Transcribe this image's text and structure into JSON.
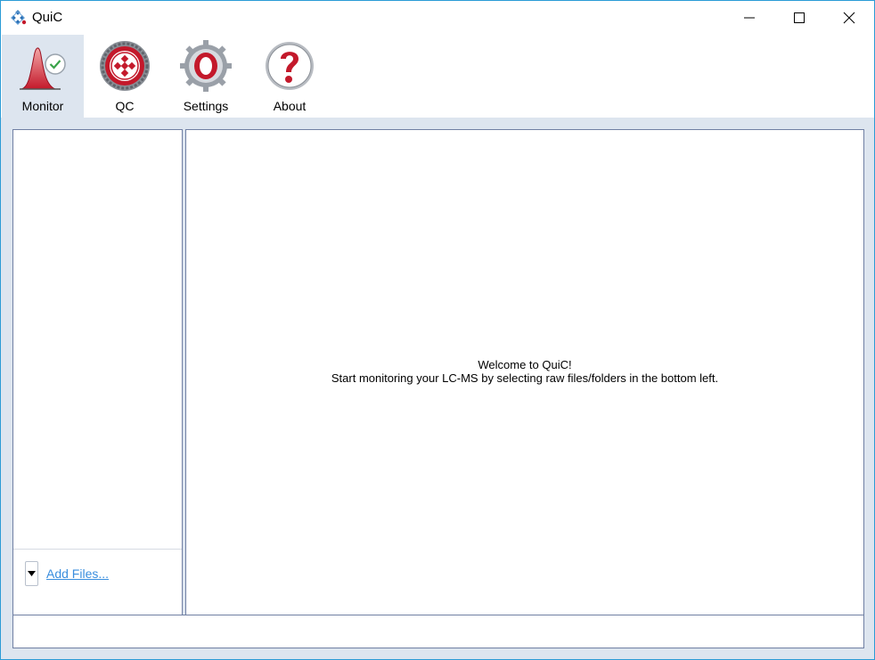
{
  "window": {
    "title": "QuiC",
    "minimize_icon": "minimize-icon",
    "maximize_icon": "maximize-icon",
    "close_icon": "close-icon"
  },
  "ribbon": {
    "tabs": [
      {
        "label": "Monitor",
        "icon": "monitor-peak-icon",
        "active": true
      },
      {
        "label": "QC",
        "icon": "qc-seal-icon",
        "active": false
      },
      {
        "label": "Settings",
        "icon": "settings-gear-icon",
        "active": false
      },
      {
        "label": "About",
        "icon": "help-question-icon",
        "active": false
      }
    ]
  },
  "left_panel": {
    "add_files_label": "Add Files..."
  },
  "main_panel": {
    "welcome_line1": "Welcome to QuiC!",
    "welcome_line2": "Start monitoring your LC-MS by selecting raw files/folders in the bottom left."
  },
  "colors": {
    "accent_border": "#2b9bd6",
    "panel_bg": "#dde5ef",
    "link": "#3a8ede",
    "brand_red": "#c3192b"
  }
}
